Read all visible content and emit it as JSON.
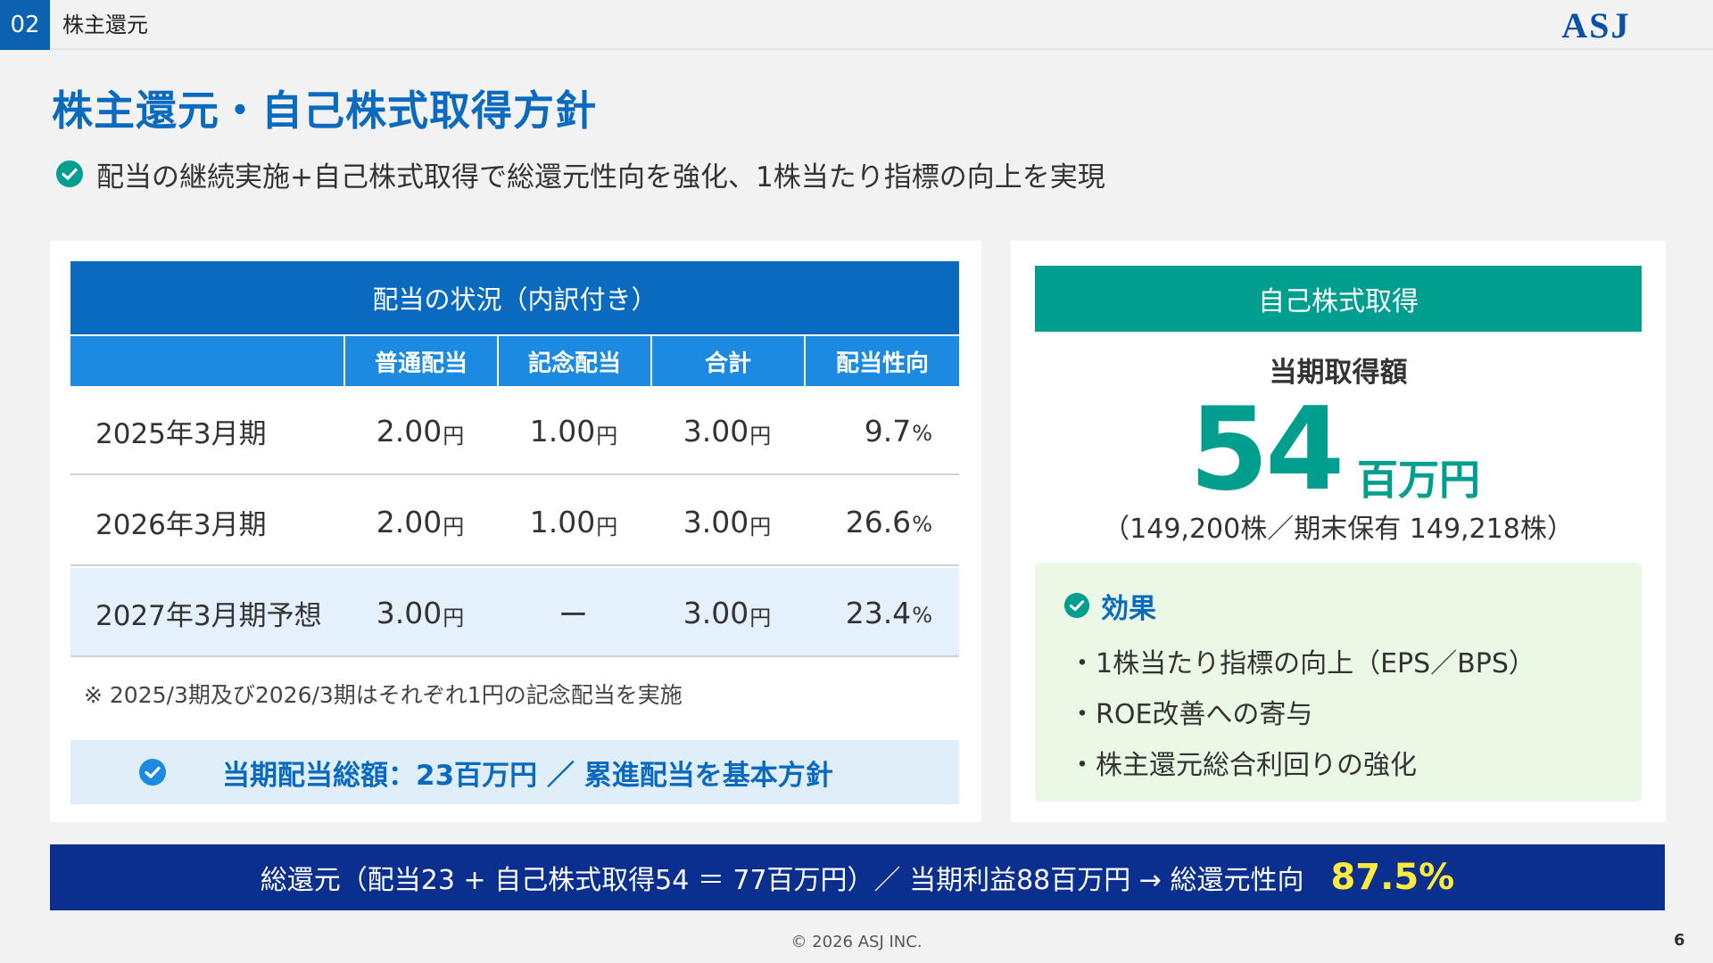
{
  "header": {
    "section_number": "02",
    "section_name": "株主還元",
    "logo_text": "ASJ"
  },
  "title": "株主還元・自己株式取得方針",
  "lead": "配当の継続実施+自己株式取得で総還元性向を強化、1株当たり指標の向上を実現",
  "dividend_table": {
    "title": "配当の状況（内訳付き）",
    "columns": [
      "",
      "普通配当",
      "記念配当",
      "合計",
      "配当性向"
    ],
    "rows": [
      {
        "period": "2025年3月期",
        "ordinary": "2.00",
        "ordinary_unit": "円",
        "commemorative": "1.00",
        "commemorative_unit": "円",
        "total": "3.00",
        "total_unit": "円",
        "payout": "9.7",
        "payout_unit": "%"
      },
      {
        "period": "2026年3月期",
        "ordinary": "2.00",
        "ordinary_unit": "円",
        "commemorative": "1.00",
        "commemorative_unit": "円",
        "total": "3.00",
        "total_unit": "円",
        "payout": "26.6",
        "payout_unit": "%"
      },
      {
        "period": "2027年3月期予想",
        "ordinary": "3.00",
        "ordinary_unit": "円",
        "commemorative": "ー",
        "commemorative_unit": "",
        "total": "3.00",
        "total_unit": "円",
        "payout": "23.4",
        "payout_unit": "%"
      }
    ],
    "note": "※ 2025/3期及び2026/3期はそれぞれ1円の記念配当を実施",
    "summary": "当期配当総額：23百万円 ／ 累進配当を基本方針"
  },
  "buyback": {
    "title": "自己株式取得",
    "label": "当期取得額",
    "amount": "54",
    "amount_unit": "百万円",
    "shares": "（149,200株／期末保有 149,218株）",
    "effects_title": "効果",
    "effects": [
      "・1株当たり指標の向上（EPS／BPS）",
      "・ROE改善への寄与",
      "・株主還元総合利回りの強化"
    ]
  },
  "bottom": {
    "text": "総還元（配当23 + 自己株式取得54 ＝ 77百万円）／ 当期利益88百万円 → 総還元性向",
    "ratio": "87.5%"
  },
  "footer": {
    "copyright": "© 2026 ASJ INC.",
    "page_number": "6"
  },
  "colors": {
    "primary_blue": "#0a6ac0",
    "teal": "#009e8e",
    "navy": "#0a2f8f",
    "highlight_yellow": "#ffeb3b"
  }
}
